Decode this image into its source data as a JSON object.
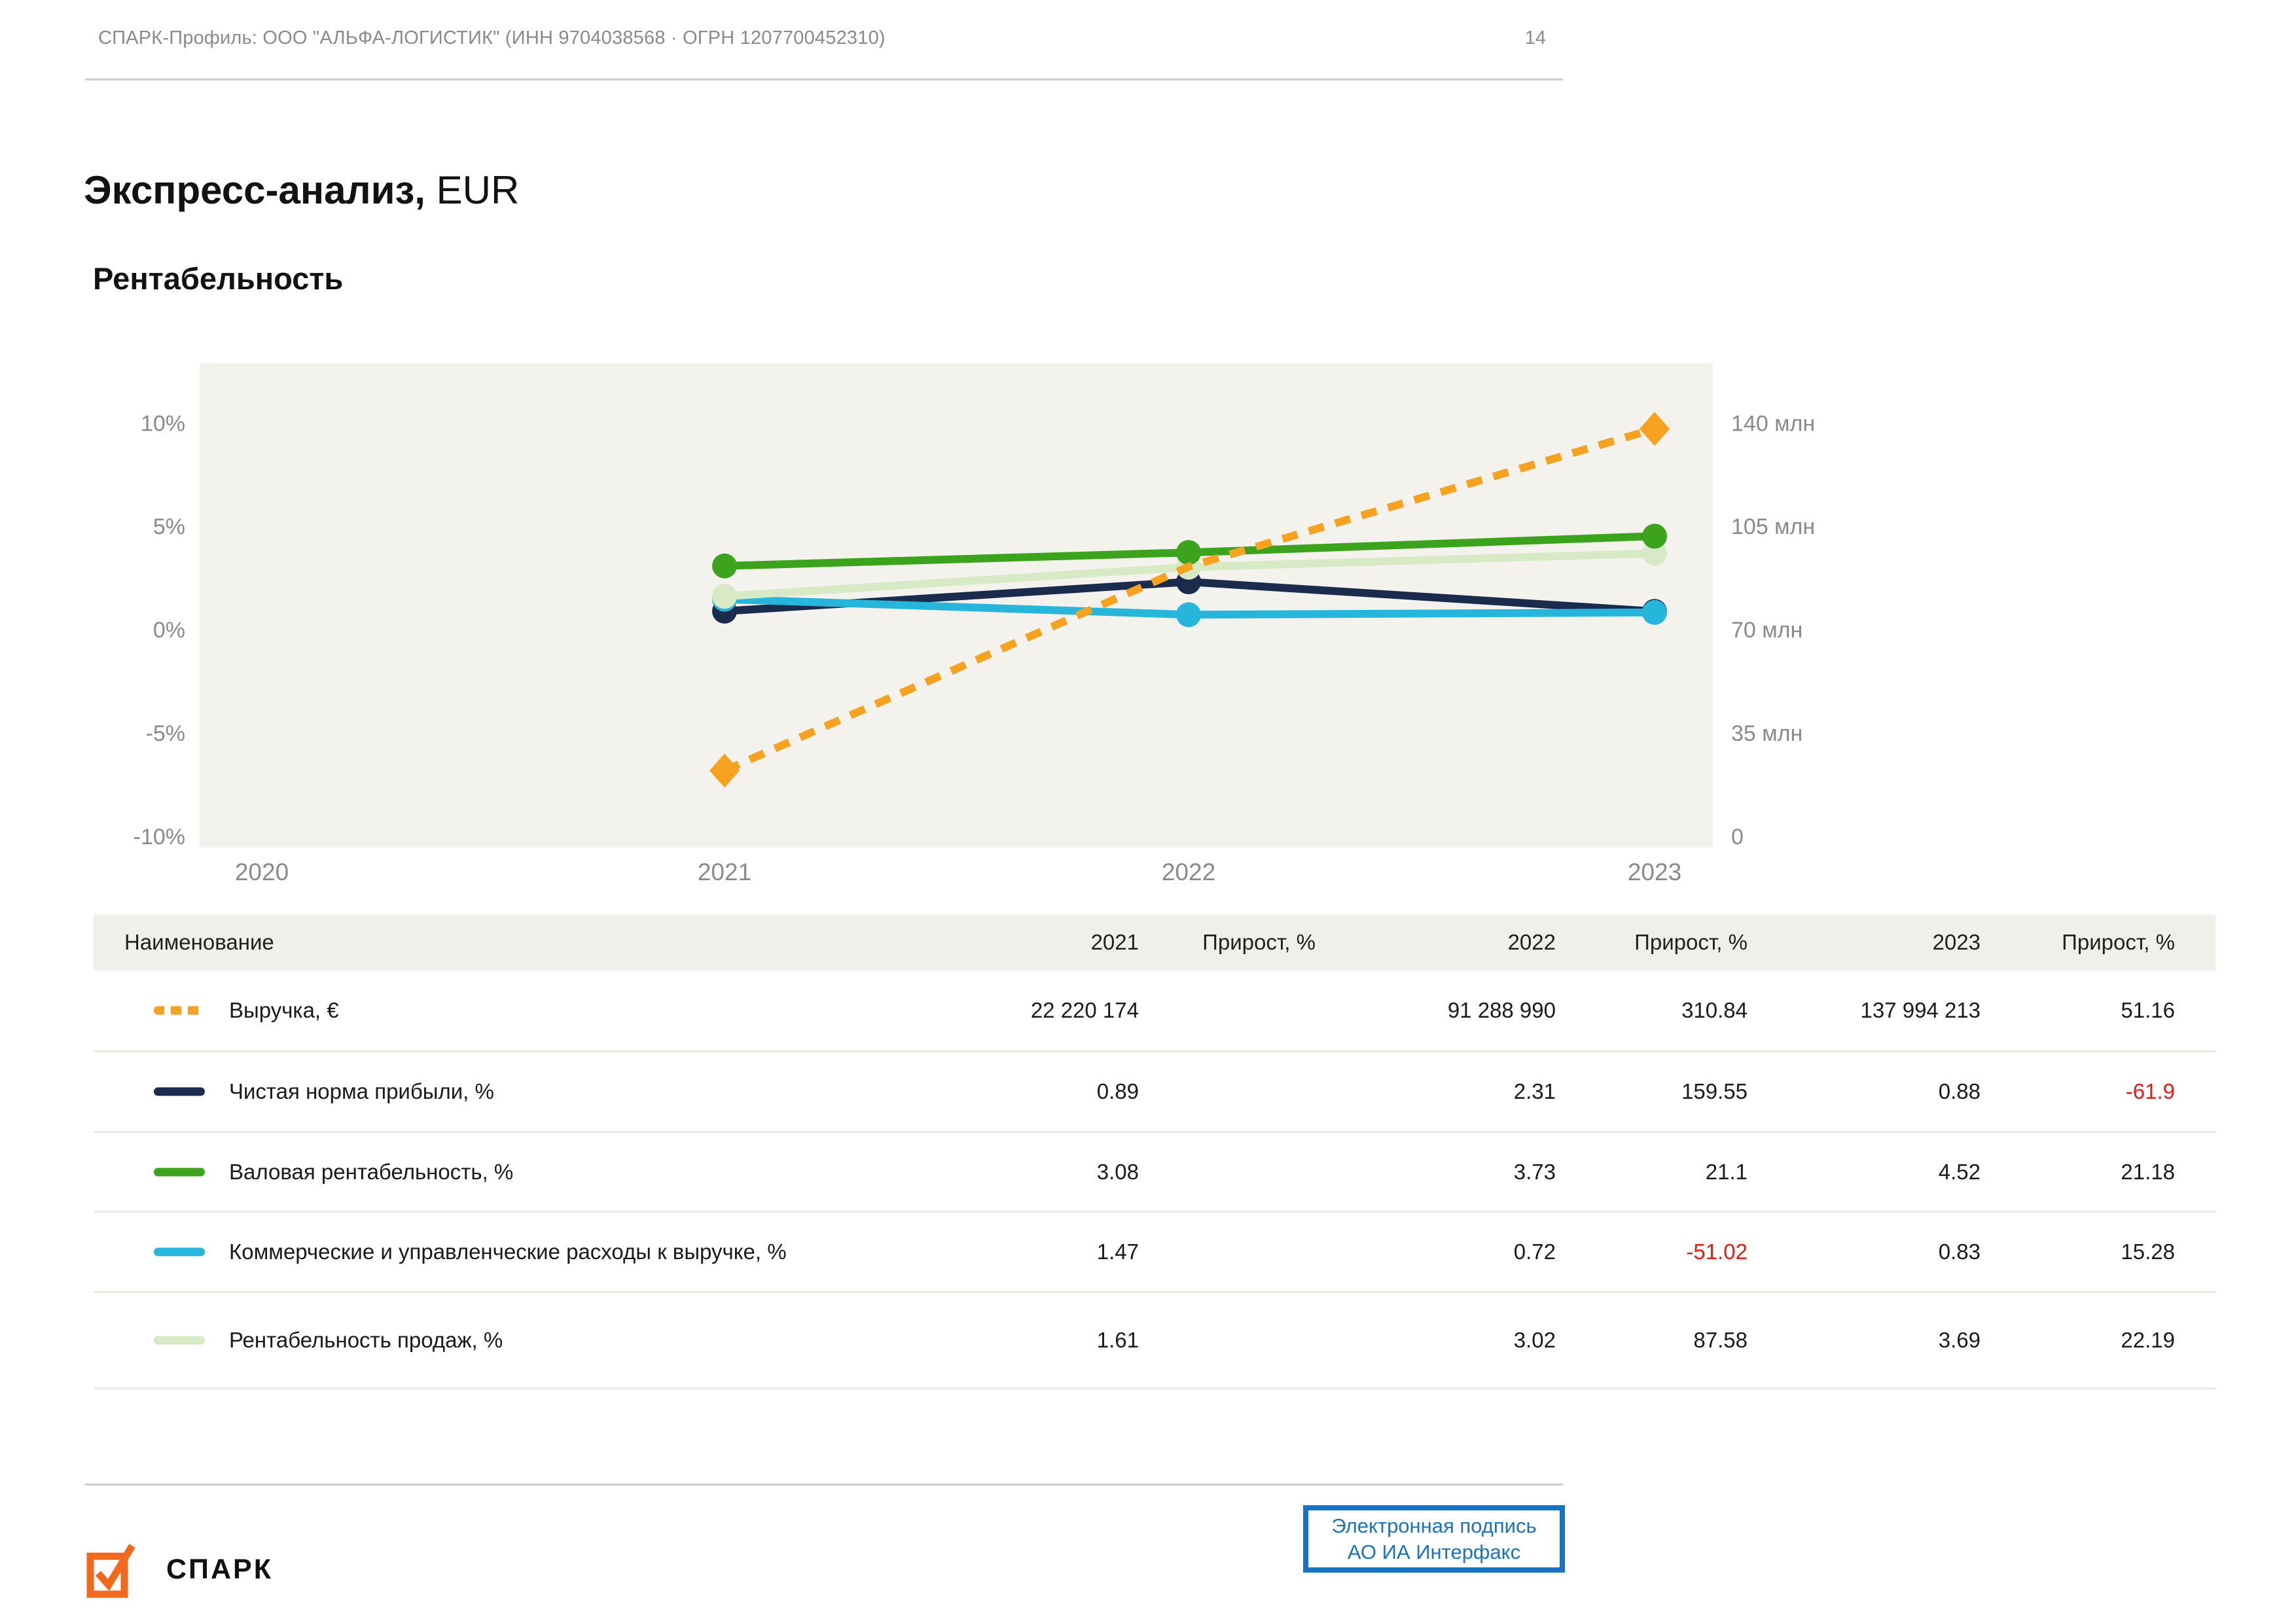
{
  "page": {
    "header": "СПАРК-Профиль: ООО \"АЛЬФА-ЛОГИСТИК\" (ИНН 9704038568 · ОГРН 1207700452310)",
    "page_number": "14",
    "title_bold": "Экспресс-анализ,",
    "title_suffix": " EUR",
    "section_title": "Рентабельность"
  },
  "colors": {
    "accent_orange": "#F7A21E",
    "logo_orange": "#F2691D",
    "navy": "#1B2B4D",
    "green": "#3CA41C",
    "cyan": "#27B6DB",
    "pale_green": "#D8E9C6",
    "negative_red": "#E81812",
    "signature_blue": "#1673C5",
    "chart_bg": "#F4F2ED",
    "table_header_bg": "#F1EFE9",
    "text_gray": "#8A8A8A",
    "text_dark": "#1A1A1A"
  },
  "chart_data": {
    "type": "line",
    "title": "Рентабельность",
    "grid": false,
    "legend_position": "table-below",
    "x_categories": [
      "2020",
      "2021",
      "2022",
      "2023"
    ],
    "left_axis": {
      "unit": "%",
      "ticks": [
        10,
        5,
        0,
        -5,
        -10
      ],
      "labels": [
        "10%",
        "5%",
        "0%",
        "-5%",
        "-10%"
      ],
      "range": [
        -11.6,
        13.2
      ]
    },
    "right_axis": {
      "unit": "млн",
      "ticks": [
        140,
        105,
        70,
        35,
        0
      ],
      "labels": [
        "140 млн",
        "105 млн",
        "70 млн",
        "35 млн",
        "0"
      ]
    },
    "series": [
      {
        "name": "Чистая норма прибыли, %",
        "axis": "left",
        "color": "#1B2B4D",
        "line": "solid",
        "marker": "circle",
        "x": [
          "2021",
          "2022",
          "2023"
        ],
        "values": [
          0.89,
          2.31,
          0.88
        ]
      },
      {
        "name": "Коммерческие и управленческие расходы к выручке, %",
        "axis": "left",
        "color": "#27B6DB",
        "line": "solid",
        "marker": "circle",
        "x": [
          "2021",
          "2022",
          "2023"
        ],
        "values": [
          1.47,
          0.72,
          0.83
        ]
      },
      {
        "name": "Рентабельность продаж, %",
        "axis": "left",
        "color": "#D8E9C6",
        "line": "solid",
        "marker": "circle",
        "x": [
          "2021",
          "2022",
          "2023"
        ],
        "values": [
          1.61,
          3.02,
          3.69
        ]
      },
      {
        "name": "Валовая рентабельность, %",
        "axis": "left",
        "color": "#3CA41C",
        "line": "solid",
        "marker": "circle",
        "x": [
          "2021",
          "2022",
          "2023"
        ],
        "values": [
          3.08,
          3.73,
          4.52
        ]
      },
      {
        "name": "Выручка, €",
        "axis": "right",
        "color": "#F7A21E",
        "line": "dashed",
        "marker": "diamond",
        "marker_visible": [
          true,
          false,
          true
        ],
        "x": [
          "2021",
          "2022",
          "2023"
        ],
        "values": [
          22220174,
          91288990,
          137994213
        ],
        "values_mln": [
          22.22,
          91.29,
          137.99
        ]
      }
    ]
  },
  "table": {
    "headers": {
      "name": "Наименование",
      "y2021": "2021",
      "growth1": "Прирост, %",
      "y2022": "2022",
      "growth2": "Прирост, %",
      "y2023": "2023",
      "growth3": "Прирост, %"
    },
    "rows": [
      {
        "name": "Выручка, €",
        "color": "#F7A21E",
        "swatch_style": "dashed",
        "v2021": "22 220 174",
        "g2021": "",
        "v2022": "91 288 990",
        "g2022": "310.84",
        "v2023": "137 994 213",
        "g2023": "51.16"
      },
      {
        "name": "Чистая норма прибыли, %",
        "color": "#1B2B4D",
        "swatch_style": "solid",
        "v2021": "0.89",
        "g2021": "",
        "v2022": "2.31",
        "g2022": "159.55",
        "v2023": "0.88",
        "g2023": "-61.9"
      },
      {
        "name": "Валовая рентабельность, %",
        "color": "#3CA41C",
        "swatch_style": "solid",
        "v2021": "3.08",
        "g2021": "",
        "v2022": "3.73",
        "g2022": "21.1",
        "v2023": "4.52",
        "g2023": "21.18"
      },
      {
        "name": "Коммерческие и управленческие расходы к выручке, %",
        "color": "#27B6DB",
        "swatch_style": "solid",
        "v2021": "1.47",
        "g2021": "",
        "v2022": "0.72",
        "g2022": "-51.02",
        "v2023": "0.83",
        "g2023": "15.28"
      },
      {
        "name": "Рентабельность продаж, %",
        "color": "#D8E9C6",
        "swatch_style": "solid",
        "v2021": "1.61",
        "g2021": "",
        "v2022": "3.02",
        "g2022": "87.58",
        "v2023": "3.69",
        "g2023": "22.19"
      }
    ]
  },
  "footer": {
    "logo_text": "СПАРК",
    "signature_line1": "Электронная подпись",
    "signature_line2": "АО ИА Интерфакс"
  }
}
